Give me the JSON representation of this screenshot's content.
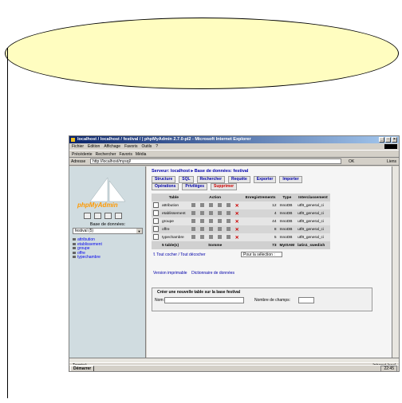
{
  "browser": {
    "title": "localhost / localhost / festival / | phpMyAdmin 2.7.0-pl2 - Microsoft Internet Explorer",
    "menu": [
      "Fichier",
      "Edition",
      "Affichage",
      "Favoris",
      "Outils",
      "?"
    ],
    "toolbar": [
      "Précédente",
      "Rechercher",
      "Favoris",
      "Média"
    ],
    "address_label": "Adresse",
    "address": "http://localhost/mysql/",
    "go_label": "OK",
    "links_label": "Liens"
  },
  "sidebar": {
    "logo_text": "phpMyAdmin",
    "db_label": "Base de données:",
    "db_selected": "festival (5)",
    "tables": [
      "attribution",
      "etablissement",
      "groupe",
      "offre",
      "typechambre"
    ]
  },
  "main": {
    "breadcrumb": "Serveur: localhost ▸ Base de données: festival",
    "tabs_row1": [
      "Structure",
      "SQL",
      "Rechercher",
      "Requête",
      "Exporter",
      "Importer"
    ],
    "tabs_row2": [
      "Opérations",
      "Privilèges",
      "Supprimer"
    ],
    "table_headers": [
      "Table",
      "Action",
      "Enregistrements",
      "Type",
      "Interclassement"
    ],
    "rows": [
      {
        "name": "attribution",
        "records": "12",
        "type": "InnoDB",
        "collation": "utf8_general_ci"
      },
      {
        "name": "etablissement",
        "records": "4",
        "type": "InnoDB",
        "collation": "utf8_general_ci"
      },
      {
        "name": "groupe",
        "records": "44",
        "type": "InnoDB",
        "collation": "utf8_general_ci"
      },
      {
        "name": "offre",
        "records": "8",
        "type": "InnoDB",
        "collation": "utf8_general_ci"
      },
      {
        "name": "typechambre",
        "records": "5",
        "type": "InnoDB",
        "collation": "utf8_general_ci"
      }
    ],
    "footer": {
      "count": "5 table(s)",
      "sum": "Somme",
      "records": "73",
      "type": "MyISAM",
      "collation": "latin1_swedish"
    },
    "check_all": "Tout cocher / Tout décocher",
    "with_selected": "Pour la sélection :",
    "print_view": "Version imprimable",
    "data_dict": "Dictionnaire de données",
    "create_head": "Créer une nouvelle table sur la base festival",
    "name_label": "Nom:",
    "fields_label": "Nombre de champs:"
  },
  "status": {
    "left": "Terminé",
    "right": "Intranet local"
  },
  "taskbar": {
    "start": "Démarrer",
    "clock": "22:45"
  }
}
